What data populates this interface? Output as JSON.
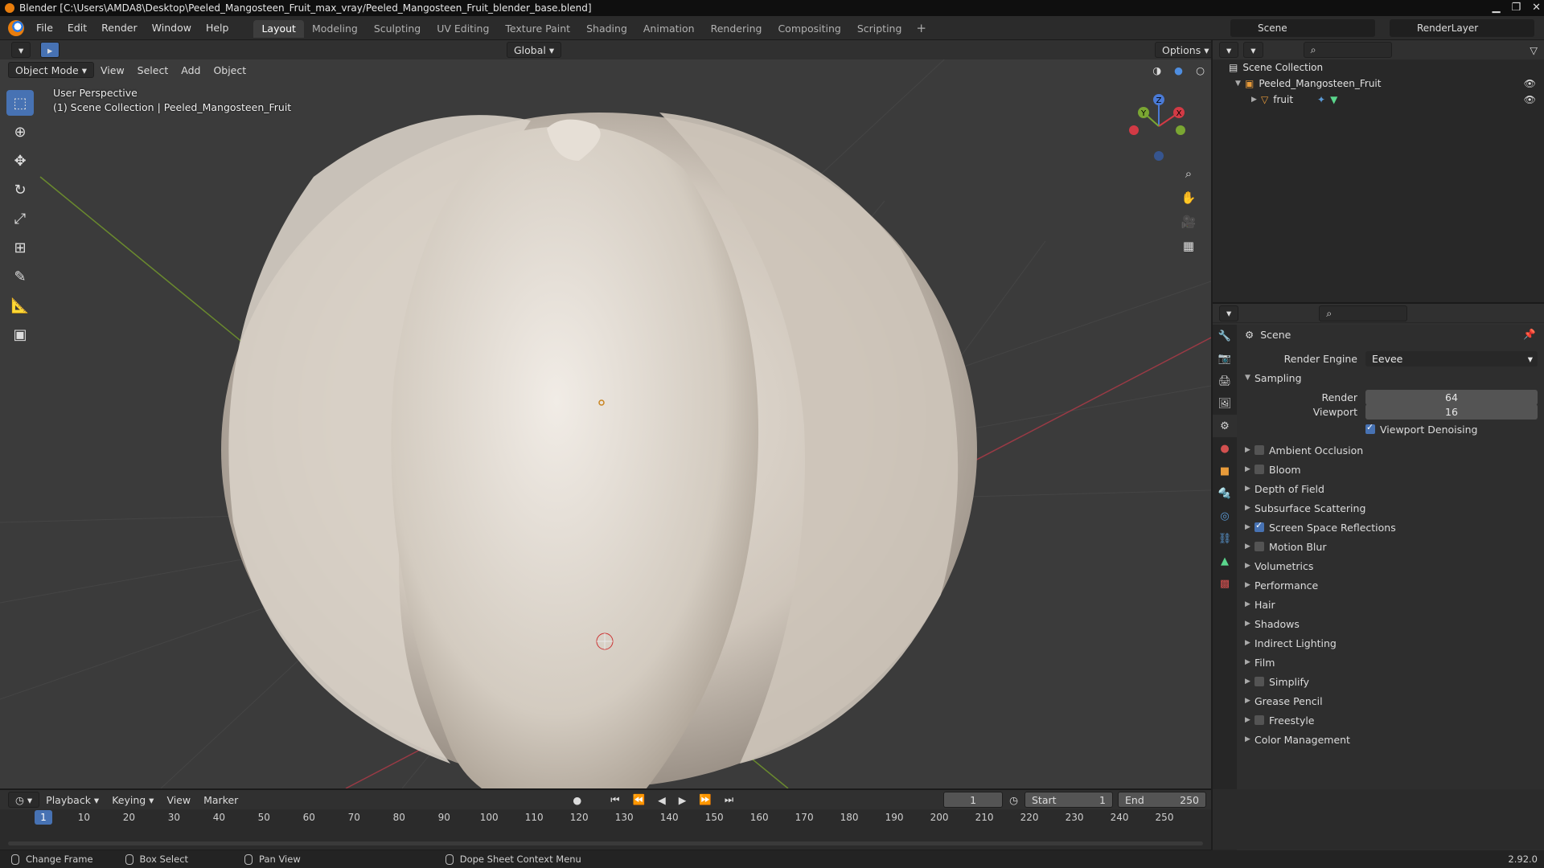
{
  "window": {
    "title": "Blender [C:\\Users\\AMDA8\\Desktop\\Peeled_Mangosteen_Fruit_max_vray/Peeled_Mangosteen_Fruit_blender_base.blend]",
    "controls": [
      "▁",
      "❐",
      "✕"
    ]
  },
  "menubar": {
    "items": [
      "File",
      "Edit",
      "Render",
      "Window",
      "Help"
    ],
    "workspaces": [
      "Layout",
      "Modeling",
      "Sculpting",
      "UV Editing",
      "Texture Paint",
      "Shading",
      "Animation",
      "Rendering",
      "Compositing",
      "Scripting"
    ],
    "active_workspace": "Layout",
    "add_tab": "+",
    "scene_name": "Scene",
    "render_layer": "RenderLayer"
  },
  "viewport": {
    "orientation": "Global",
    "options_label": "Options",
    "mode": "Object Mode",
    "menus": [
      "View",
      "Select",
      "Add",
      "Object"
    ],
    "overlay_line1": "User Perspective",
    "overlay_line2": "(1) Scene Collection | Peeled_Mangosteen_Fruit",
    "gizmo_axes": {
      "x": "X",
      "y": "Y",
      "z": "Z"
    }
  },
  "outliner": {
    "root": "Scene Collection",
    "collection": "Peeled_Mangosteen_Fruit",
    "object": "fruit"
  },
  "properties": {
    "context": "Scene",
    "render_engine_label": "Render Engine",
    "render_engine_value": "Eevee",
    "sampling": {
      "title": "Sampling",
      "render_label": "Render",
      "render_value": "64",
      "viewport_label": "Viewport",
      "viewport_value": "16",
      "denoise_label": "Viewport Denoising",
      "denoise_checked": true
    },
    "panels": [
      {
        "label": "Ambient Occlusion",
        "checkbox": true,
        "checked": false
      },
      {
        "label": "Bloom",
        "checkbox": true,
        "checked": false
      },
      {
        "label": "Depth of Field",
        "checkbox": false,
        "checked": false
      },
      {
        "label": "Subsurface Scattering",
        "checkbox": false,
        "checked": false
      },
      {
        "label": "Screen Space Reflections",
        "checkbox": true,
        "checked": true
      },
      {
        "label": "Motion Blur",
        "checkbox": true,
        "checked": false
      },
      {
        "label": "Volumetrics",
        "checkbox": false,
        "checked": false
      },
      {
        "label": "Performance",
        "checkbox": false,
        "checked": false
      },
      {
        "label": "Hair",
        "checkbox": false,
        "checked": false
      },
      {
        "label": "Shadows",
        "checkbox": false,
        "checked": false
      },
      {
        "label": "Indirect Lighting",
        "checkbox": false,
        "checked": false
      },
      {
        "label": "Film",
        "checkbox": false,
        "checked": false
      },
      {
        "label": "Simplify",
        "checkbox": true,
        "checked": false
      },
      {
        "label": "Grease Pencil",
        "checkbox": false,
        "checked": false
      },
      {
        "label": "Freestyle",
        "checkbox": true,
        "checked": false
      },
      {
        "label": "Color Management",
        "checkbox": false,
        "checked": false
      }
    ]
  },
  "timeline": {
    "menus": [
      "Playback",
      "Keying",
      "View",
      "Marker"
    ],
    "current_frame": "1",
    "start_label": "Start",
    "start_value": "1",
    "end_label": "End",
    "end_value": "250",
    "ruler_labels": [
      "1",
      "10",
      "20",
      "30",
      "40",
      "50",
      "60",
      "70",
      "80",
      "90",
      "100",
      "110",
      "120",
      "130",
      "140",
      "150",
      "160",
      "170",
      "180",
      "190",
      "200",
      "210",
      "220",
      "230",
      "240",
      "250"
    ]
  },
  "statusbar": {
    "items": [
      "Change Frame",
      "Box Select",
      "Pan View",
      "Dope Sheet Context Menu"
    ],
    "version": "2.92.0"
  },
  "colors": {
    "accent": "#4772b3",
    "viewport_bg": "#3b3b3b",
    "panel_bg": "#303030"
  }
}
